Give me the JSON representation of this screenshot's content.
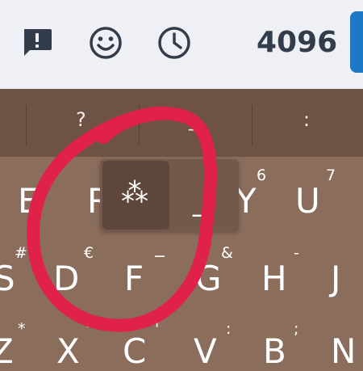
{
  "status_bar": {
    "icons": [
      "message-alert-icon",
      "smiley-icon",
      "clock-icon"
    ],
    "count": "4096",
    "accent_color": "#1e78c8"
  },
  "keyboard": {
    "suggestions": [
      "?",
      "_",
      ":"
    ],
    "row1": [
      {
        "key": "E",
        "hint": ""
      },
      {
        "key": "R",
        "hint": ""
      },
      {
        "key": "Y",
        "hint": "6"
      },
      {
        "key": "U",
        "hint": "7"
      }
    ],
    "row2": [
      {
        "key": "S",
        "hint": "#"
      },
      {
        "key": "D",
        "hint": "€"
      },
      {
        "key": "F",
        "hint": "−"
      },
      {
        "key": "G",
        "hint": "&"
      },
      {
        "key": "H",
        "hint": "-"
      },
      {
        "key": "J",
        "hint": ""
      }
    ],
    "row3": [
      {
        "key": "Z",
        "hint": "*"
      },
      {
        "key": "X",
        "hint": "\""
      },
      {
        "key": "C",
        "hint": "'"
      },
      {
        "key": "V",
        "hint": ":"
      },
      {
        "key": "B",
        "hint": ";"
      },
      {
        "key": "N",
        "hint": ""
      }
    ],
    "popup": {
      "selected": "⁂",
      "alternate": "_"
    },
    "annotation_color": "#e0224a"
  }
}
